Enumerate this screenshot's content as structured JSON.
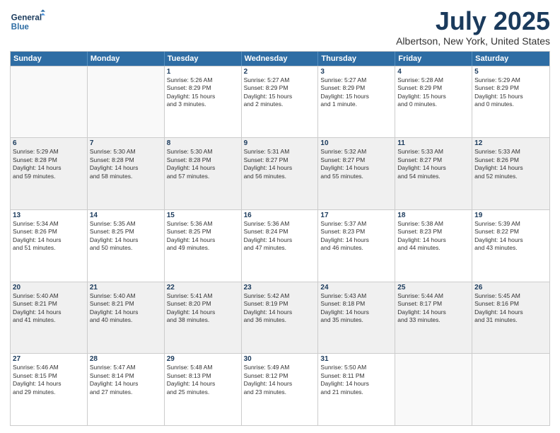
{
  "logo": {
    "line1": "General",
    "line2": "Blue"
  },
  "title": "July 2025",
  "subtitle": "Albertson, New York, United States",
  "weekdays": [
    "Sunday",
    "Monday",
    "Tuesday",
    "Wednesday",
    "Thursday",
    "Friday",
    "Saturday"
  ],
  "rows": [
    [
      {
        "day": "",
        "empty": true,
        "lines": []
      },
      {
        "day": "",
        "empty": true,
        "lines": []
      },
      {
        "day": "1",
        "shaded": false,
        "lines": [
          "Sunrise: 5:26 AM",
          "Sunset: 8:29 PM",
          "Daylight: 15 hours",
          "and 3 minutes."
        ]
      },
      {
        "day": "2",
        "shaded": false,
        "lines": [
          "Sunrise: 5:27 AM",
          "Sunset: 8:29 PM",
          "Daylight: 15 hours",
          "and 2 minutes."
        ]
      },
      {
        "day": "3",
        "shaded": false,
        "lines": [
          "Sunrise: 5:27 AM",
          "Sunset: 8:29 PM",
          "Daylight: 15 hours",
          "and 1 minute."
        ]
      },
      {
        "day": "4",
        "shaded": false,
        "lines": [
          "Sunrise: 5:28 AM",
          "Sunset: 8:29 PM",
          "Daylight: 15 hours",
          "and 0 minutes."
        ]
      },
      {
        "day": "5",
        "shaded": false,
        "lines": [
          "Sunrise: 5:29 AM",
          "Sunset: 8:29 PM",
          "Daylight: 15 hours",
          "and 0 minutes."
        ]
      }
    ],
    [
      {
        "day": "6",
        "shaded": true,
        "lines": [
          "Sunrise: 5:29 AM",
          "Sunset: 8:28 PM",
          "Daylight: 14 hours",
          "and 59 minutes."
        ]
      },
      {
        "day": "7",
        "shaded": true,
        "lines": [
          "Sunrise: 5:30 AM",
          "Sunset: 8:28 PM",
          "Daylight: 14 hours",
          "and 58 minutes."
        ]
      },
      {
        "day": "8",
        "shaded": true,
        "lines": [
          "Sunrise: 5:30 AM",
          "Sunset: 8:28 PM",
          "Daylight: 14 hours",
          "and 57 minutes."
        ]
      },
      {
        "day": "9",
        "shaded": true,
        "lines": [
          "Sunrise: 5:31 AM",
          "Sunset: 8:27 PM",
          "Daylight: 14 hours",
          "and 56 minutes."
        ]
      },
      {
        "day": "10",
        "shaded": true,
        "lines": [
          "Sunrise: 5:32 AM",
          "Sunset: 8:27 PM",
          "Daylight: 14 hours",
          "and 55 minutes."
        ]
      },
      {
        "day": "11",
        "shaded": true,
        "lines": [
          "Sunrise: 5:33 AM",
          "Sunset: 8:27 PM",
          "Daylight: 14 hours",
          "and 54 minutes."
        ]
      },
      {
        "day": "12",
        "shaded": true,
        "lines": [
          "Sunrise: 5:33 AM",
          "Sunset: 8:26 PM",
          "Daylight: 14 hours",
          "and 52 minutes."
        ]
      }
    ],
    [
      {
        "day": "13",
        "shaded": false,
        "lines": [
          "Sunrise: 5:34 AM",
          "Sunset: 8:26 PM",
          "Daylight: 14 hours",
          "and 51 minutes."
        ]
      },
      {
        "day": "14",
        "shaded": false,
        "lines": [
          "Sunrise: 5:35 AM",
          "Sunset: 8:25 PM",
          "Daylight: 14 hours",
          "and 50 minutes."
        ]
      },
      {
        "day": "15",
        "shaded": false,
        "lines": [
          "Sunrise: 5:36 AM",
          "Sunset: 8:25 PM",
          "Daylight: 14 hours",
          "and 49 minutes."
        ]
      },
      {
        "day": "16",
        "shaded": false,
        "lines": [
          "Sunrise: 5:36 AM",
          "Sunset: 8:24 PM",
          "Daylight: 14 hours",
          "and 47 minutes."
        ]
      },
      {
        "day": "17",
        "shaded": false,
        "lines": [
          "Sunrise: 5:37 AM",
          "Sunset: 8:23 PM",
          "Daylight: 14 hours",
          "and 46 minutes."
        ]
      },
      {
        "day": "18",
        "shaded": false,
        "lines": [
          "Sunrise: 5:38 AM",
          "Sunset: 8:23 PM",
          "Daylight: 14 hours",
          "and 44 minutes."
        ]
      },
      {
        "day": "19",
        "shaded": false,
        "lines": [
          "Sunrise: 5:39 AM",
          "Sunset: 8:22 PM",
          "Daylight: 14 hours",
          "and 43 minutes."
        ]
      }
    ],
    [
      {
        "day": "20",
        "shaded": true,
        "lines": [
          "Sunrise: 5:40 AM",
          "Sunset: 8:21 PM",
          "Daylight: 14 hours",
          "and 41 minutes."
        ]
      },
      {
        "day": "21",
        "shaded": true,
        "lines": [
          "Sunrise: 5:40 AM",
          "Sunset: 8:21 PM",
          "Daylight: 14 hours",
          "and 40 minutes."
        ]
      },
      {
        "day": "22",
        "shaded": true,
        "lines": [
          "Sunrise: 5:41 AM",
          "Sunset: 8:20 PM",
          "Daylight: 14 hours",
          "and 38 minutes."
        ]
      },
      {
        "day": "23",
        "shaded": true,
        "lines": [
          "Sunrise: 5:42 AM",
          "Sunset: 8:19 PM",
          "Daylight: 14 hours",
          "and 36 minutes."
        ]
      },
      {
        "day": "24",
        "shaded": true,
        "lines": [
          "Sunrise: 5:43 AM",
          "Sunset: 8:18 PM",
          "Daylight: 14 hours",
          "and 35 minutes."
        ]
      },
      {
        "day": "25",
        "shaded": true,
        "lines": [
          "Sunrise: 5:44 AM",
          "Sunset: 8:17 PM",
          "Daylight: 14 hours",
          "and 33 minutes."
        ]
      },
      {
        "day": "26",
        "shaded": true,
        "lines": [
          "Sunrise: 5:45 AM",
          "Sunset: 8:16 PM",
          "Daylight: 14 hours",
          "and 31 minutes."
        ]
      }
    ],
    [
      {
        "day": "27",
        "shaded": false,
        "lines": [
          "Sunrise: 5:46 AM",
          "Sunset: 8:15 PM",
          "Daylight: 14 hours",
          "and 29 minutes."
        ]
      },
      {
        "day": "28",
        "shaded": false,
        "lines": [
          "Sunrise: 5:47 AM",
          "Sunset: 8:14 PM",
          "Daylight: 14 hours",
          "and 27 minutes."
        ]
      },
      {
        "day": "29",
        "shaded": false,
        "lines": [
          "Sunrise: 5:48 AM",
          "Sunset: 8:13 PM",
          "Daylight: 14 hours",
          "and 25 minutes."
        ]
      },
      {
        "day": "30",
        "shaded": false,
        "lines": [
          "Sunrise: 5:49 AM",
          "Sunset: 8:12 PM",
          "Daylight: 14 hours",
          "and 23 minutes."
        ]
      },
      {
        "day": "31",
        "shaded": false,
        "lines": [
          "Sunrise: 5:50 AM",
          "Sunset: 8:11 PM",
          "Daylight: 14 hours",
          "and 21 minutes."
        ]
      },
      {
        "day": "",
        "empty": true,
        "lines": []
      },
      {
        "day": "",
        "empty": true,
        "lines": []
      }
    ]
  ]
}
